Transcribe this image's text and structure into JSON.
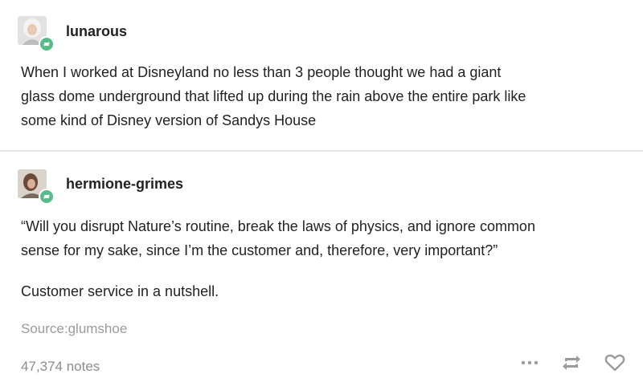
{
  "posts": [
    {
      "username": "lunarous",
      "avatar_icon": "user-avatar",
      "badge_icon": "reblog-icon",
      "lines": [
        "When I worked at Disneyland no less than 3 people thought we had a giant",
        "glass dome underground that lifted up during the rain above the entire park like",
        "some kind of Disney version of Sandys House"
      ]
    },
    {
      "username": "hermione-grimes",
      "avatar_icon": "user-avatar",
      "badge_icon": "reblog-icon",
      "quote_lines": [
        "“Will you disrupt Nature’s routine, break the laws of physics, and ignore common",
        "sense for my sake, since I’m the customer and, therefore, very important?”"
      ],
      "text": "Customer service in a nutshell."
    }
  ],
  "footer": {
    "source": "Source:glumshoe",
    "notes": "47,374 notes",
    "actions": [
      "more-icon",
      "reblog-icon",
      "heart-icon"
    ]
  },
  "colors": {
    "badge": "#56bc8a",
    "divider": "#e7e7e7",
    "muted": "#9a9a9a"
  }
}
